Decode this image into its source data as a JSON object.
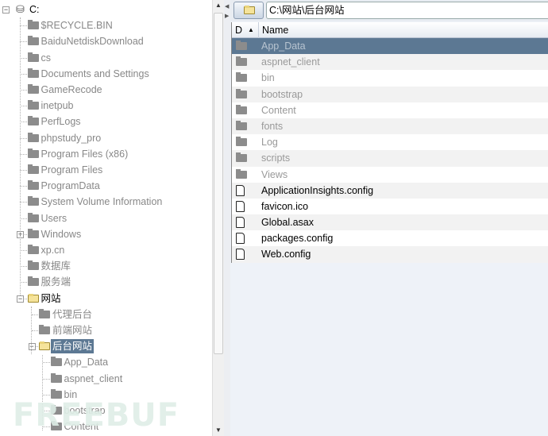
{
  "tree": [
    {
      "label": "C:",
      "level": 0,
      "icon": "drive-icon",
      "expander": "minus",
      "state": "open"
    },
    {
      "label": "$RECYCLE.BIN",
      "level": 1
    },
    {
      "label": "BaiduNetdiskDownload",
      "level": 1
    },
    {
      "label": "cs",
      "level": 1
    },
    {
      "label": "Documents and Settings",
      "level": 1
    },
    {
      "label": "GameRecode",
      "level": 1
    },
    {
      "label": "inetpub",
      "level": 1
    },
    {
      "label": "PerfLogs",
      "level": 1
    },
    {
      "label": "phpstudy_pro",
      "level": 1
    },
    {
      "label": "Program Files (x86)",
      "level": 1
    },
    {
      "label": "Program Files",
      "level": 1
    },
    {
      "label": "ProgramData",
      "level": 1
    },
    {
      "label": "System Volume Information",
      "level": 1
    },
    {
      "label": "Users",
      "level": 1
    },
    {
      "label": "Windows",
      "level": 1,
      "expander": "plus"
    },
    {
      "label": "xp.cn",
      "level": 1
    },
    {
      "label": "数据库",
      "level": 1
    },
    {
      "label": "服务端",
      "level": 1
    },
    {
      "label": "网站",
      "level": 1,
      "expander": "minus",
      "state": "open"
    },
    {
      "label": "代理后台",
      "level": 2
    },
    {
      "label": "前端网站",
      "level": 2
    },
    {
      "label": "后台网站",
      "level": 2,
      "expander": "minus",
      "state": "selected"
    },
    {
      "label": "App_Data",
      "level": 3
    },
    {
      "label": "aspnet_client",
      "level": 3
    },
    {
      "label": "bin",
      "level": 3
    },
    {
      "label": "bootstrap",
      "level": 3
    },
    {
      "label": "Content",
      "level": 3
    }
  ],
  "path": "C:\\网站\\后台网站",
  "list_header": {
    "col_d": "D",
    "sort": "▲",
    "col_name": "Name"
  },
  "files": [
    {
      "name": "App_Data",
      "type": "folder",
      "selected": true
    },
    {
      "name": "aspnet_client",
      "type": "folder"
    },
    {
      "name": "bin",
      "type": "folder"
    },
    {
      "name": "bootstrap",
      "type": "folder"
    },
    {
      "name": "Content",
      "type": "folder"
    },
    {
      "name": "fonts",
      "type": "folder"
    },
    {
      "name": "Log",
      "type": "folder"
    },
    {
      "name": "scripts",
      "type": "folder"
    },
    {
      "name": "Views",
      "type": "folder"
    },
    {
      "name": "ApplicationInsights.config",
      "type": "file"
    },
    {
      "name": "favicon.ico",
      "type": "file"
    },
    {
      "name": "Global.asax",
      "type": "file"
    },
    {
      "name": "packages.config",
      "type": "file"
    },
    {
      "name": "Web.config",
      "type": "file"
    }
  ],
  "watermark": "FREEBUF",
  "colors": {
    "selection": "#5c7893",
    "folder": "#8c8c8c",
    "open_folder": "#f5e39a"
  }
}
